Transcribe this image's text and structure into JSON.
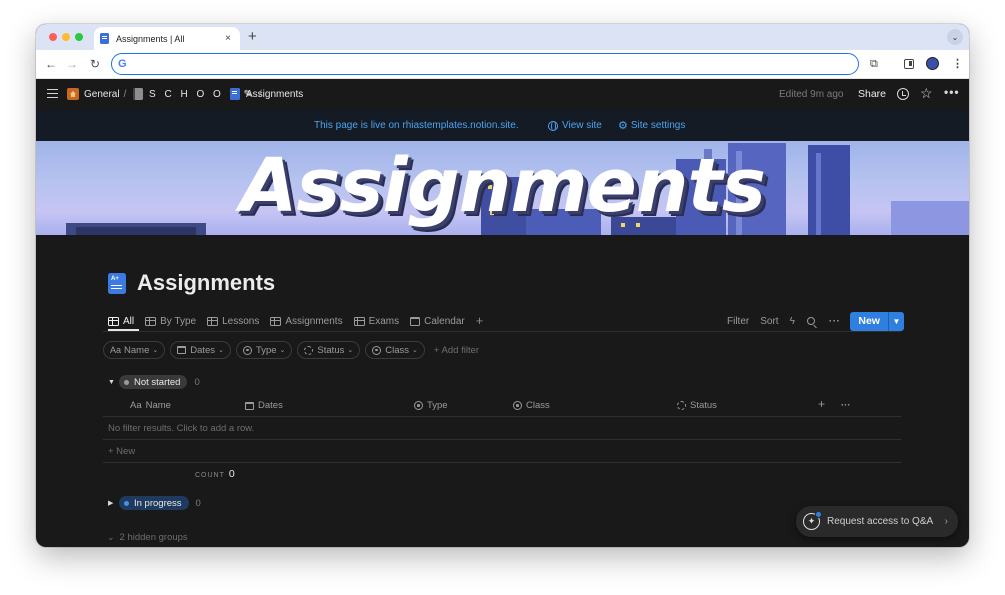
{
  "browser": {
    "tab_title": "Assignments | All",
    "tab_close": "×",
    "new_tab": "+",
    "tabs_menu": "⌄",
    "address_value": "",
    "google_glyph": "G",
    "back": "←",
    "forward": "→",
    "reload": "↻",
    "extensions": "⧉",
    "menu": "⋮"
  },
  "topbar": {
    "breadcrumb": [
      {
        "label": "General",
        "sep": "/"
      },
      {
        "label": "S C H O O L ✎",
        "sep": "/"
      },
      {
        "label": "Assignments"
      }
    ],
    "edited": "Edited 9m ago",
    "share": "Share",
    "star": "☆",
    "more": "•••"
  },
  "banner": {
    "text": "This page is live on rhiastemplates.notion.site.",
    "view_site": "View site",
    "site_settings": "Site settings",
    "gear": "⚙"
  },
  "cover": {
    "title": "Assignments"
  },
  "page": {
    "title": "Assignments"
  },
  "views": {
    "tabs": [
      {
        "label": "All",
        "icon": "table-icon"
      },
      {
        "label": "By Type",
        "icon": "table-icon"
      },
      {
        "label": "Lessons",
        "icon": "table-icon"
      },
      {
        "label": "Assignments",
        "icon": "table-icon"
      },
      {
        "label": "Exams",
        "icon": "table-icon"
      },
      {
        "label": "Calendar",
        "icon": "calendar-icon"
      }
    ],
    "add": "+"
  },
  "actions": {
    "filter": "Filter",
    "sort": "Sort",
    "bolt": "ϟ",
    "dots": "···",
    "new": "New",
    "new_drop": "▼"
  },
  "filters": {
    "name": {
      "prefix": "Aa",
      "label": "Name"
    },
    "dates": {
      "label": "Dates"
    },
    "type": {
      "label": "Type"
    },
    "status": {
      "label": "Status"
    },
    "class": {
      "label": "Class"
    },
    "caret": "⌄",
    "add": "+ Add filter"
  },
  "groups": {
    "not_started": {
      "toggle": "▼",
      "label": "Not started",
      "count": "0",
      "pill_color": "#3a3a3a",
      "dot_color": "#9b9b9b"
    },
    "in_progress": {
      "toggle": "▶",
      "label": "In progress",
      "count": "0",
      "pill_color": "#1f3a5f",
      "dot_color": "#4a8fe0"
    },
    "hidden": {
      "chev": "⌄",
      "label": "2 hidden groups"
    }
  },
  "columns": {
    "name_prefix": "Aa",
    "name": "Name",
    "dates": "Dates",
    "type": "Type",
    "class": "Class",
    "status": "Status",
    "add": "+",
    "more": "···"
  },
  "table": {
    "empty": "No filter results. Click to add a row.",
    "new_row": "+ New",
    "count_label": "COUNT",
    "count_value": "0"
  },
  "qa": {
    "icon": "✦",
    "label": "Request access to Q&A",
    "chev": "›"
  }
}
